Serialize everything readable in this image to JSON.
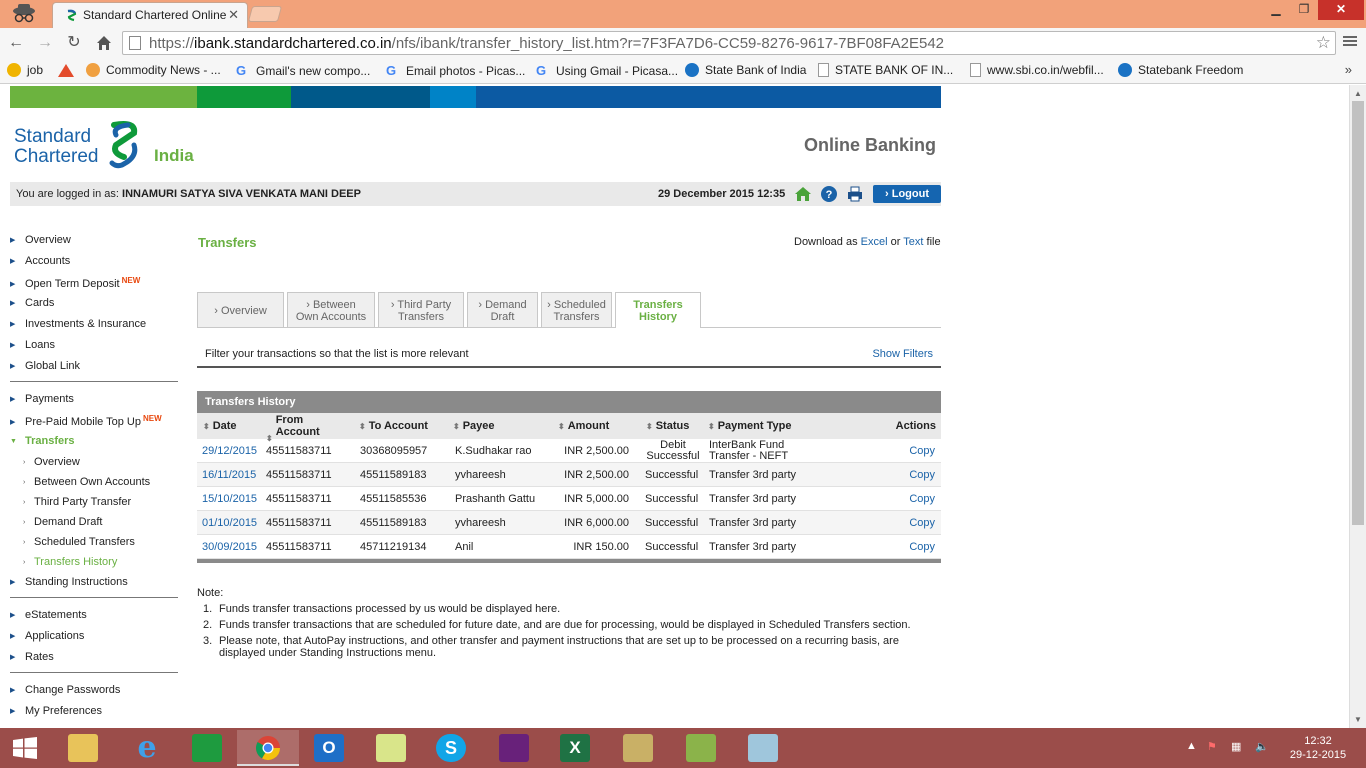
{
  "browser": {
    "tab_title": "Standard Chartered Online",
    "url_prefix": "https://",
    "url_host": "ibank.standardchartered.co.in",
    "url_path": "/nfs/ibank/transfer_history_list.htm?r=7F3FA7D6-CC59-8276-9617-7BF08FA2E542",
    "bookmarks": [
      {
        "label": "job",
        "icon": "smiley-icon",
        "color": "#f0b400"
      },
      {
        "label": "",
        "icon": "triangle-icon",
        "color": "#e34b2c"
      },
      {
        "label": "Commodity News - ...",
        "icon": "commodity-icon",
        "color": "#f0a040"
      },
      {
        "label": "Gmail's new compo...",
        "icon": "google-icon",
        "color": "#4285f4"
      },
      {
        "label": "Email photos - Picas...",
        "icon": "google-icon",
        "color": "#4285f4"
      },
      {
        "label": "Using Gmail - Picasa...",
        "icon": "google-icon",
        "color": "#4285f4"
      },
      {
        "label": "State Bank of India",
        "icon": "sbi-icon",
        "color": "#1a72c4"
      },
      {
        "label": "STATE BANK OF IN...",
        "icon": "page-icon",
        "color": "#999999"
      },
      {
        "label": "www.sbi.co.in/webfil...",
        "icon": "page-icon",
        "color": "#999999"
      },
      {
        "label": "Statebank Freedom",
        "icon": "sbi-icon",
        "color": "#1a72c4"
      }
    ],
    "bookmarks_more": "»"
  },
  "brand": {
    "colors": [
      "#6cb33f",
      "#0e9a3a",
      "#00598a",
      "#0083c7",
      "#0c5aa3"
    ],
    "logo_line1": "Standard",
    "logo_line2": "Chartered",
    "logo_region": "India",
    "online_banking": "Online Banking"
  },
  "userbar": {
    "logged_in_label": "You are logged in as:",
    "user_name": "INNAMURI SATYA SIVA VENKATA MANI DEEP",
    "datetime": "29 December 2015 12:35",
    "logout_label": "Logout"
  },
  "nav": {
    "group1": [
      "Overview",
      "Accounts",
      "Open Term Deposit",
      "Cards",
      "Investments & Insurance",
      "Loans",
      "Global Link"
    ],
    "new_badge": "NEW",
    "group2_payments": "Payments",
    "group2_prepaid": "Pre-Paid Mobile Top Up",
    "group2_transfers": "Transfers",
    "transfers_sub": [
      "Overview",
      "Between Own Accounts",
      "Third Party Transfer",
      "Demand Draft",
      "Scheduled Transfers",
      "Transfers History"
    ],
    "standing": "Standing Instructions",
    "group3": [
      "eStatements",
      "Applications",
      "Rates"
    ],
    "group4": [
      "Change Passwords",
      "My Preferences"
    ]
  },
  "content": {
    "section_title": "Transfers",
    "download_prefix": "Download as",
    "download_excel": "Excel",
    "download_or": "or",
    "download_text": "Text",
    "download_suffix": "file",
    "tabs": [
      {
        "line1": "› Overview",
        "line2": ""
      },
      {
        "line1": "› Between",
        "line2": "Own Accounts"
      },
      {
        "line1": "› Third Party",
        "line2": "Transfers"
      },
      {
        "line1": "› Demand",
        "line2": "Draft"
      },
      {
        "line1": "› Scheduled",
        "line2": "Transfers"
      },
      {
        "line1": "Transfers",
        "line2": "History"
      }
    ],
    "filter_text": "Filter your transactions so that the list is more relevant",
    "show_filters": "Show Filters"
  },
  "table": {
    "title": "Transfers History",
    "headers": {
      "date": "Date",
      "from1": "From",
      "from2": "Account",
      "to": "To Account",
      "payee": "Payee",
      "amount": "Amount",
      "status": "Status",
      "ptype": "Payment Type",
      "actions": "Actions"
    },
    "rows": [
      {
        "date": "29/12/2015",
        "from": "45511583711",
        "to": "30368095957",
        "payee": "K.Sudhakar rao",
        "amount": "INR 2,500.00",
        "status1": "Debit",
        "status2": "Successful",
        "ptype1": "InterBank Fund",
        "ptype2": "Transfer  - NEFT",
        "action": "Copy"
      },
      {
        "date": "16/11/2015",
        "from": "45511583711",
        "to": "45511589183",
        "payee": "yvhareesh",
        "amount": "INR 2,500.00",
        "status1": "Successful",
        "status2": "",
        "ptype1": "Transfer 3rd party",
        "ptype2": "",
        "action": "Copy"
      },
      {
        "date": "15/10/2015",
        "from": "45511583711",
        "to": "45511585536",
        "payee": "Prashanth Gattu",
        "amount": "INR 5,000.00",
        "status1": "Successful",
        "status2": "",
        "ptype1": "Transfer 3rd party",
        "ptype2": "",
        "action": "Copy"
      },
      {
        "date": "01/10/2015",
        "from": "45511583711",
        "to": "45511589183",
        "payee": "yvhareesh",
        "amount": "INR 6,000.00",
        "status1": "Successful",
        "status2": "",
        "ptype1": "Transfer 3rd party",
        "ptype2": "",
        "action": "Copy"
      },
      {
        "date": "30/09/2015",
        "from": "45511583711",
        "to": "45711219134",
        "payee": "Anil",
        "amount": "INR 150.00",
        "status1": "Successful",
        "status2": "",
        "ptype1": "Transfer 3rd party",
        "ptype2": "",
        "action": "Copy"
      }
    ]
  },
  "notes": {
    "label": "Note:",
    "items": [
      {
        "num": "1.",
        "line1": "Funds transfer transactions processed by us would be displayed here.",
        "line2": ""
      },
      {
        "num": "2.",
        "line1": "Funds transfer transactions that are scheduled for future date, and are due for processing, would be displayed in Scheduled Transfers section.",
        "line2": ""
      },
      {
        "num": "3.",
        "line1": "Please note, that AutoPay instructions, and other transfer and payment instructions that are set up to be processed on a recurring basis, are",
        "line2": "displayed under Standing Instructions menu."
      }
    ]
  },
  "taskbar": {
    "apps": [
      "file-explorer-icon",
      "internet-explorer-icon",
      "store-icon",
      "chrome-icon",
      "outlook-icon",
      "sticky-notes-icon",
      "skype-icon",
      "visual-studio-icon",
      "excel-icon",
      "tools-icon",
      "notepad-icon",
      "clipboard-icon"
    ],
    "time": "12:32",
    "date": "29-12-2015"
  }
}
